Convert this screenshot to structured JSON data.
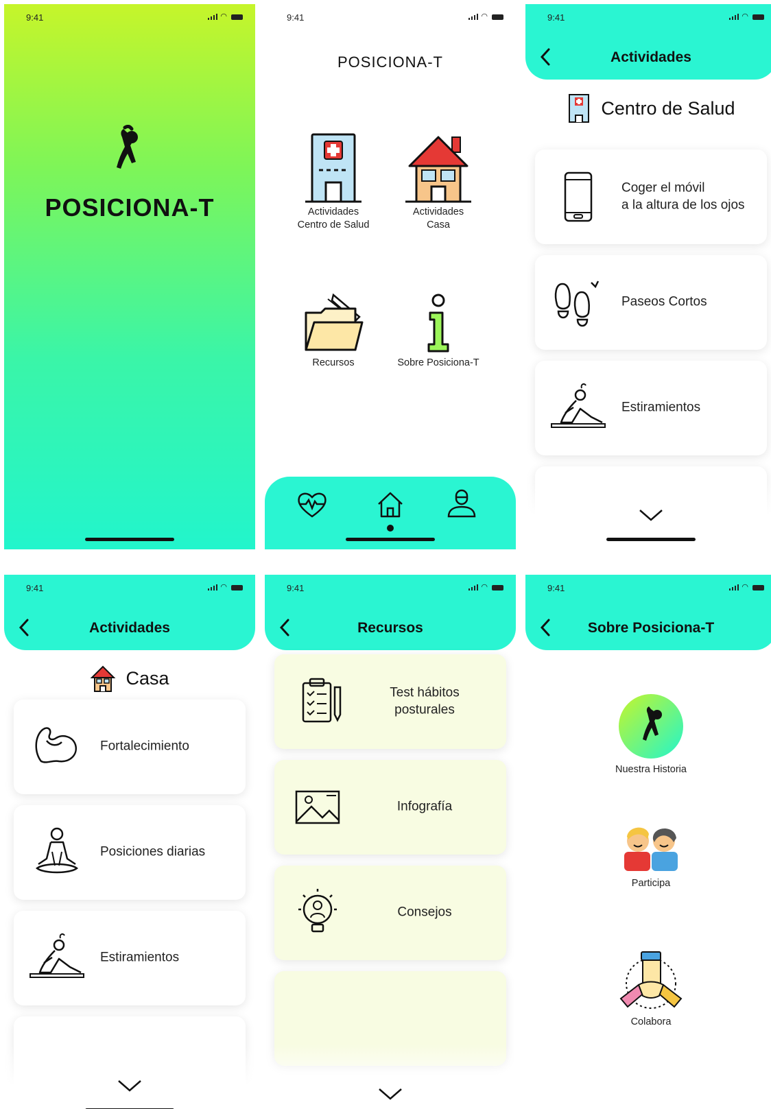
{
  "status": {
    "time": "9:41"
  },
  "app": {
    "name": "POSICIONA-T"
  },
  "menu": {
    "items": [
      {
        "line1": "Actividades",
        "line2": "Centro de Salud"
      },
      {
        "line1": "Actividades",
        "line2": "Casa"
      },
      {
        "line1": "Recursos",
        "line2": ""
      },
      {
        "line1": "Sobre Posiciona-T",
        "line2": ""
      }
    ],
    "tabs": [
      "heart-rate-icon",
      "home-icon",
      "user-icon"
    ]
  },
  "centro": {
    "header": "Actividades",
    "subtitle": "Centro de Salud",
    "items": [
      {
        "line1": "Coger el móvil",
        "line2": "a la altura de los ojos",
        "icon": "phone-icon"
      },
      {
        "line1": "Paseos Cortos",
        "line2": "",
        "icon": "footprints-icon"
      },
      {
        "line1": "Estiramientos",
        "line2": "",
        "icon": "stretching-icon"
      }
    ]
  },
  "casa": {
    "header": "Actividades",
    "subtitle": "Casa",
    "items": [
      {
        "line1": "Fortalecimiento",
        "icon": "muscle-icon"
      },
      {
        "line1": "Posiciones diarias",
        "icon": "yoga-icon"
      },
      {
        "line1": "Estiramientos",
        "icon": "stretching-icon"
      }
    ]
  },
  "recursos": {
    "header": "Recursos",
    "items": [
      {
        "line1": "Test hábitos",
        "line2": "posturales",
        "icon": "checklist-icon"
      },
      {
        "line1": "Infografía",
        "line2": "",
        "icon": "image-icon"
      },
      {
        "line1": "Consejos",
        "line2": "",
        "icon": "lightbulb-icon"
      }
    ]
  },
  "sobre": {
    "header": "Sobre Posiciona-T",
    "items": [
      {
        "label": "Nuestra Historia",
        "icon": "logo-icon"
      },
      {
        "label": "Participa",
        "icon": "people-icon"
      },
      {
        "label": "Colabora",
        "icon": "hands-icon"
      }
    ]
  },
  "colors": {
    "accent": "#2af5d2",
    "lime": "#c6f52a",
    "card_yellow": "#f8fce2"
  }
}
